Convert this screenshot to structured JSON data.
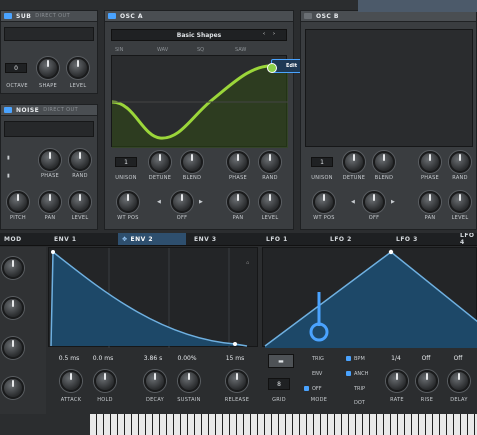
{
  "sub": {
    "title": "SUB",
    "subtitle": "DIRECT OUT",
    "octave_value": "0",
    "labels": {
      "octave": "OCTAVE",
      "shape": "SHAPE",
      "level": "LEVEL"
    }
  },
  "noise": {
    "title": "NOISE",
    "subtitle": "DIRECT OUT",
    "labels": {
      "pitch": "PITCH",
      "pan": "PAN",
      "level": "LEVEL",
      "phase": "PHASE",
      "rand": "RAND"
    }
  },
  "osc_a": {
    "title": "OSC A",
    "wavetable_name": "Basic Shapes",
    "wt_fields": [
      "SIN",
      "WAV",
      "SQ",
      "SAW"
    ],
    "tooltip": "Edit",
    "unison_value": "1",
    "labels": {
      "unison": "UNISON",
      "detune": "DETUNE",
      "blend": "BLEND",
      "phase": "PHASE",
      "rand": "RAND",
      "wt_pos": "WT POS",
      "off": "OFF",
      "pan": "PAN",
      "level": "LEVEL"
    }
  },
  "osc_b": {
    "title": "OSC B",
    "unison_value": "1",
    "labels": {
      "unison": "UNISON",
      "detune": "DETUNE",
      "blend": "BLEND",
      "phase": "PHASE",
      "rand": "RAND",
      "wt_pos": "WT POS",
      "off": "OFF",
      "pan": "PAN",
      "level": "LEVEL"
    }
  },
  "mod_tabs": [
    "MOD",
    "ENV 1",
    "ENV 2",
    "ENV 3",
    "LFO 1",
    "LFO 2",
    "LFO 3",
    "LFO 4"
  ],
  "env": {
    "values": {
      "attack": "0.5 ms",
      "hold": "0.0 ms",
      "decay": "3.86 s",
      "sustain": "0.00%",
      "release": "15 ms"
    },
    "labels": {
      "attack": "ATTACK",
      "hold": "HOLD",
      "decay": "DECAY",
      "sustain": "SUSTAIN",
      "release": "RELEASE"
    }
  },
  "lfo": {
    "grid_value": "8",
    "mode_labels": {
      "trig": "TRIG",
      "env": "ENV",
      "off": "OFF",
      "bpm": "BPM",
      "anch": "ANCH",
      "trip": "TRIP",
      "dot": "DOT"
    },
    "values": {
      "rate": "1/4",
      "rise": "Off",
      "delay": "Off"
    },
    "labels": {
      "grid": "GRID",
      "mode": "MODE",
      "rate": "RATE",
      "rise": "RISE",
      "delay": "DELAY"
    }
  },
  "colors": {
    "wave": "#9bd63a",
    "env_fill": "#1d4868",
    "accent": "#4aa3ff"
  }
}
